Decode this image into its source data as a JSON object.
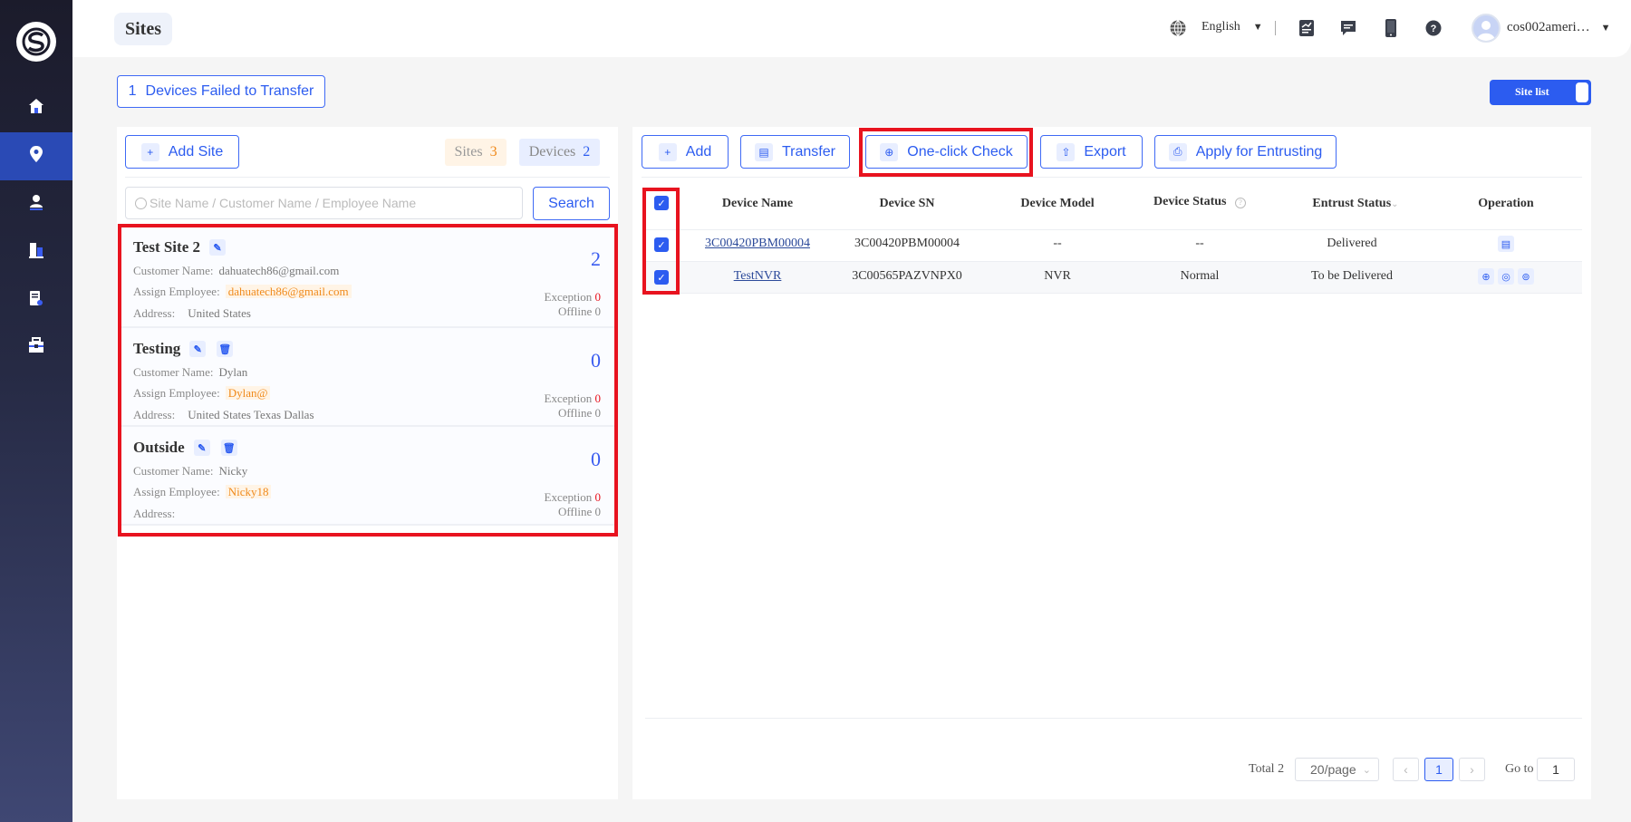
{
  "header": {
    "title": "Sites",
    "language": "English",
    "username": "cos002ameri…"
  },
  "colors": {
    "accent": "#2c5cf0",
    "sidebar_active": "#2a4ab5",
    "warning": "#f08a1c",
    "danger": "#e8131f"
  },
  "sidebar": {
    "items": [
      {
        "icon": "home-icon"
      },
      {
        "icon": "location-pin-icon",
        "active": true
      },
      {
        "icon": "user-icon"
      },
      {
        "icon": "building-icon"
      },
      {
        "icon": "report-icon"
      },
      {
        "icon": "toolbox-icon"
      }
    ]
  },
  "failed_transfer": {
    "count": "1",
    "label": "Devices Failed to Transfer"
  },
  "view_toggle": {
    "label": "Site list"
  },
  "left": {
    "add_site": "Add Site",
    "sites_label": "Sites",
    "sites_count": "3",
    "devices_label": "Devices",
    "devices_count": "2",
    "search_placeholder": "Site Name / Customer Name / Employee Name",
    "search_button": "Search",
    "labels": {
      "customer": "Customer Name:",
      "employee": "Assign Employee:",
      "address": "Address:",
      "exception": "Exception",
      "offline": "Offline"
    },
    "sites": [
      {
        "name": "Test Site 2",
        "customer": "dahuatech86@gmail.com",
        "employee": "dahuatech86@gmail.com",
        "address": "United States",
        "devices": "2",
        "exception": "0",
        "offline": "0",
        "deletable": false
      },
      {
        "name": "Testing",
        "customer": "Dylan",
        "employee": "Dylan@",
        "address": "United States Texas Dallas",
        "devices": "0",
        "exception": "0",
        "offline": "0",
        "deletable": true
      },
      {
        "name": "Outside",
        "customer": "Nicky",
        "employee": "Nicky18",
        "address": "",
        "devices": "0",
        "exception": "0",
        "offline": "0",
        "deletable": true
      }
    ]
  },
  "toolbar": {
    "add": "Add",
    "transfer": "Transfer",
    "check": "One-click Check",
    "export": "Export",
    "entrust": "Apply for Entrusting"
  },
  "table": {
    "columns": [
      "Device Name",
      "Device SN",
      "Device Model",
      "Device Status",
      "Entrust Status",
      "Operation"
    ],
    "rows": [
      {
        "name": "3C00420PBM00004",
        "sn": "3C00420PBM00004",
        "model": "--",
        "status": "--",
        "entrust": "Delivered",
        "checked": true
      },
      {
        "name": "TestNVR",
        "sn": "3C00565PAZVNPX0",
        "model": "NVR",
        "status": "Normal",
        "entrust": "To be Delivered",
        "checked": true
      }
    ]
  },
  "pagination": {
    "total": "Total 2",
    "page_size": "20/page",
    "current": "1",
    "goto_label": "Go to",
    "goto_value": "1"
  }
}
